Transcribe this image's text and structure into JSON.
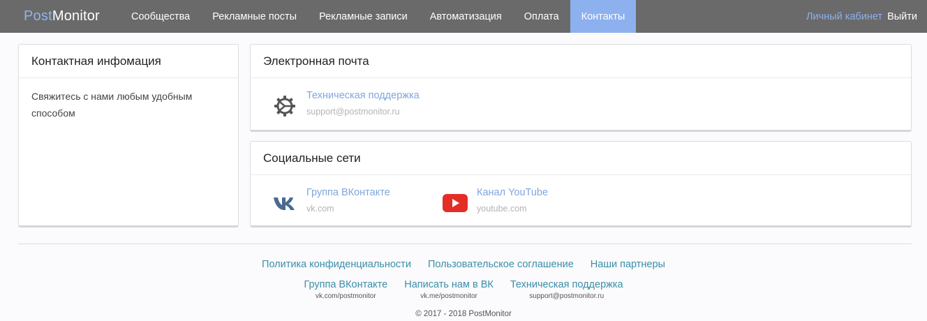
{
  "navbar": {
    "brand_part1": "Post",
    "brand_part2": "Monitor",
    "items": [
      {
        "label": "Сообщества"
      },
      {
        "label": "Рекламные посты"
      },
      {
        "label": "Рекламные записи"
      },
      {
        "label": "Автоматизация"
      },
      {
        "label": "Оплата"
      },
      {
        "label": "Контакты",
        "active": true
      }
    ],
    "cabinet_label": "Личный кабинет",
    "exit_label": "Выйти",
    "bg_color": "#6a6a6a",
    "accent_color": "#8db0ee"
  },
  "contact_info": {
    "title": "Контактная инфомация",
    "text": "Свяжитесь с нами любым удобным способом"
  },
  "email_panel": {
    "title": "Электронная почта",
    "items": [
      {
        "label": "Техническая поддержка",
        "sub": "support@postmonitor.ru",
        "icon": "gear-icon"
      }
    ]
  },
  "social_panel": {
    "title": "Социальные сети",
    "items": [
      {
        "label": "Группа ВКонтакте",
        "sub": "vk.com",
        "icon": "vk-logo-icon"
      },
      {
        "label": "Канал YouTube",
        "sub": "youtube.com",
        "icon": "youtube-logo-icon"
      }
    ]
  },
  "footer": {
    "links_row1": [
      "Политика конфиденциальности",
      "Пользовательское соглашение",
      "Наши партнеры"
    ],
    "links_row2": [
      {
        "label": "Группа ВКонтакте",
        "sub": "vk.com/postmonitor"
      },
      {
        "label": "Написать нам в ВК",
        "sub": "vk.me/postmonitor"
      },
      {
        "label": "Техническая поддержка",
        "sub": "support@postmonitor.ru"
      }
    ],
    "copyright": "© 2017 - 2018 PostMonitor",
    "link_color": "#3a8fa8"
  }
}
